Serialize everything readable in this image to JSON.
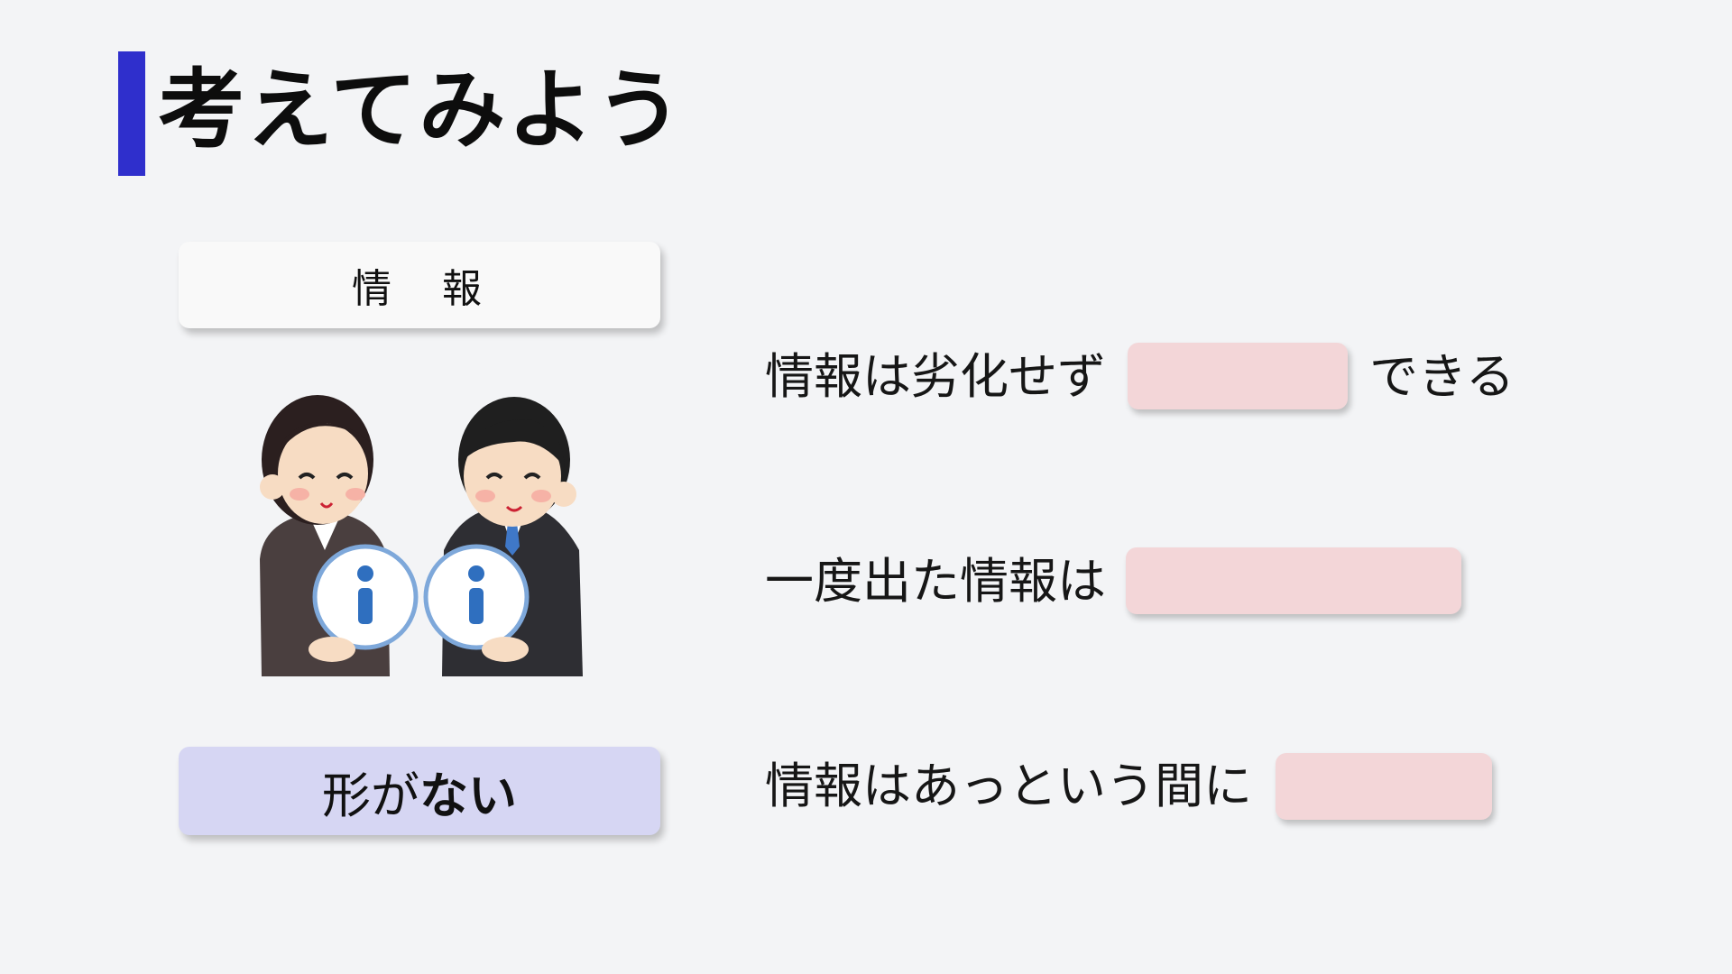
{
  "slide": {
    "title": "考えてみよう",
    "info_label": "情　報",
    "shape_label_prefix": "形が",
    "shape_label_emph": "ない",
    "sentence1_before": "情報は劣化せず",
    "sentence1_after": "できる",
    "sentence2": "一度出た情報は",
    "sentence3": "情報はあっという間に"
  },
  "colors": {
    "accent": "#2f2fcc",
    "background": "#f3f4f6",
    "blank_fill": "#f3d6d8",
    "shape_box_fill": "#d6d6f3"
  },
  "illustration": {
    "description_icon": "business-people-holding-info-icons",
    "badge_icon": "info-icon"
  }
}
